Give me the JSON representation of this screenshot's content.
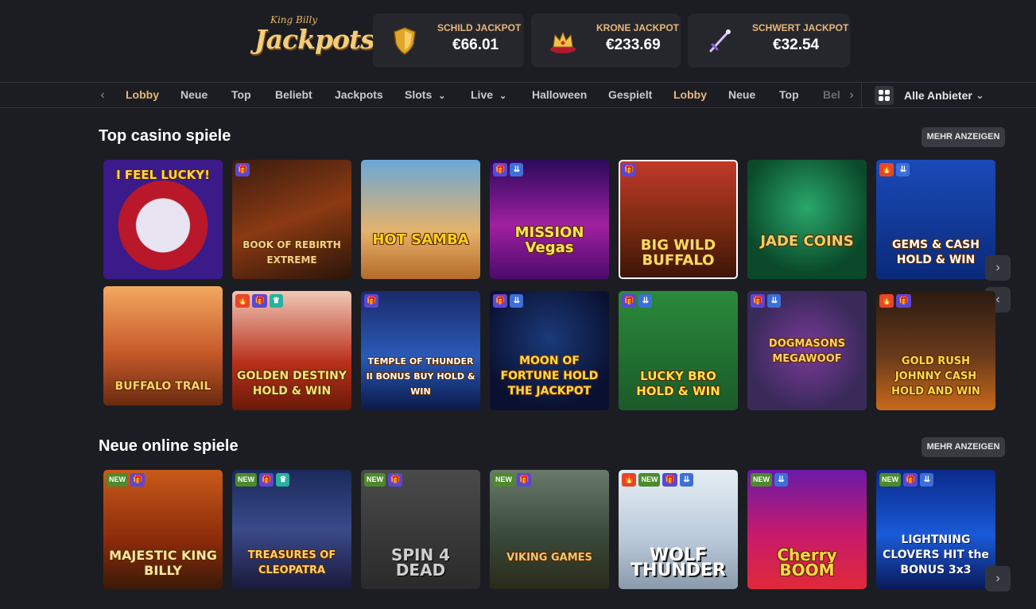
{
  "logo": {
    "line1": "King Billy",
    "line2": "Jackpots"
  },
  "jackpots": [
    {
      "name": "SCHILD JACKPOT",
      "value": "€66.01",
      "icon": "shield-icon"
    },
    {
      "name": "KRONE JACKPOT",
      "value": "€233.69",
      "icon": "crown-icon"
    },
    {
      "name": "SCHWERT JACKPOT",
      "value": "€32.54",
      "icon": "sword-icon"
    }
  ],
  "nav": {
    "items": [
      "Lobby",
      "Neue",
      "Top",
      "Beliebt",
      "Jackpots",
      "Slots",
      "Live",
      "Halloween",
      "Gespielt",
      "Lobby",
      "Neue",
      "Top",
      "Bel"
    ],
    "provider_label": "Alle Anbieter"
  },
  "sections": {
    "top": {
      "title": "Top casino spiele",
      "more": "MEHR ANZEIGEN",
      "tiles": [
        "I FEEL LUCKY!",
        "BOOK OF REBIRTH EXTREME",
        "HOT SAMBA",
        "MISSION Vegas",
        "BIG WILD BUFFALO",
        "JADE COINS",
        "GEMS & CASH HOLD & WIN",
        "BUFFALO TRAIL",
        "GOLDEN DESTINY HOLD & WIN",
        "TEMPLE OF THUNDER II BONUS BUY HOLD & WIN",
        "MOON OF FORTUNE HOLD THE JACKPOT",
        "LUCKY BRO HOLD & WIN",
        "DOGMASONS MEGAWOOF",
        "GOLD RUSH JOHNNY CASH HOLD AND WIN"
      ]
    },
    "new": {
      "title": "Neue online spiele",
      "more": "MEHR ANZEIGEN",
      "tiles": [
        "MAJESTIC KING BILLY",
        "TREASURES OF CLEOPATRA",
        "SPIN 4 DEAD",
        "VIKING GAMES",
        "WOLF THUNDER",
        "Cherry BOOM",
        "LIGHTNING CLOVERS HIT the BONUS 3x3"
      ]
    }
  },
  "badges": {
    "new": "NEW",
    "gift": "🎁",
    "drop": "⇊",
    "fire": "🔥",
    "rank": "♛"
  },
  "colors": {
    "accent": "#e7b87a",
    "background": "#1c1d22",
    "panel": "#26272d"
  }
}
